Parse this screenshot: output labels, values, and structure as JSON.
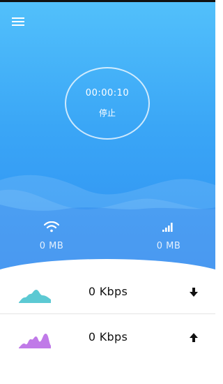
{
  "header": {
    "menu_icon": "menu-icon"
  },
  "timer": {
    "elapsed": "00:00:10",
    "stop_label": "停止"
  },
  "stats": {
    "wifi": {
      "icon": "wifi-icon",
      "value": "0 MB"
    },
    "mobile": {
      "icon": "signal-bars-icon",
      "value": "0 MB"
    }
  },
  "speeds": {
    "download": {
      "graph_icon": "download-graph-icon",
      "value": "0 Kbps",
      "direction_icon": "arrow-down-icon",
      "color": "#5cc9d3"
    },
    "upload": {
      "graph_icon": "upload-graph-icon",
      "value": "0 Kbps",
      "direction_icon": "arrow-up-icon",
      "color": "#c07ae8"
    }
  },
  "colors": {
    "hero_top": "#52c0fb",
    "hero_bottom": "#2f8ef2"
  }
}
